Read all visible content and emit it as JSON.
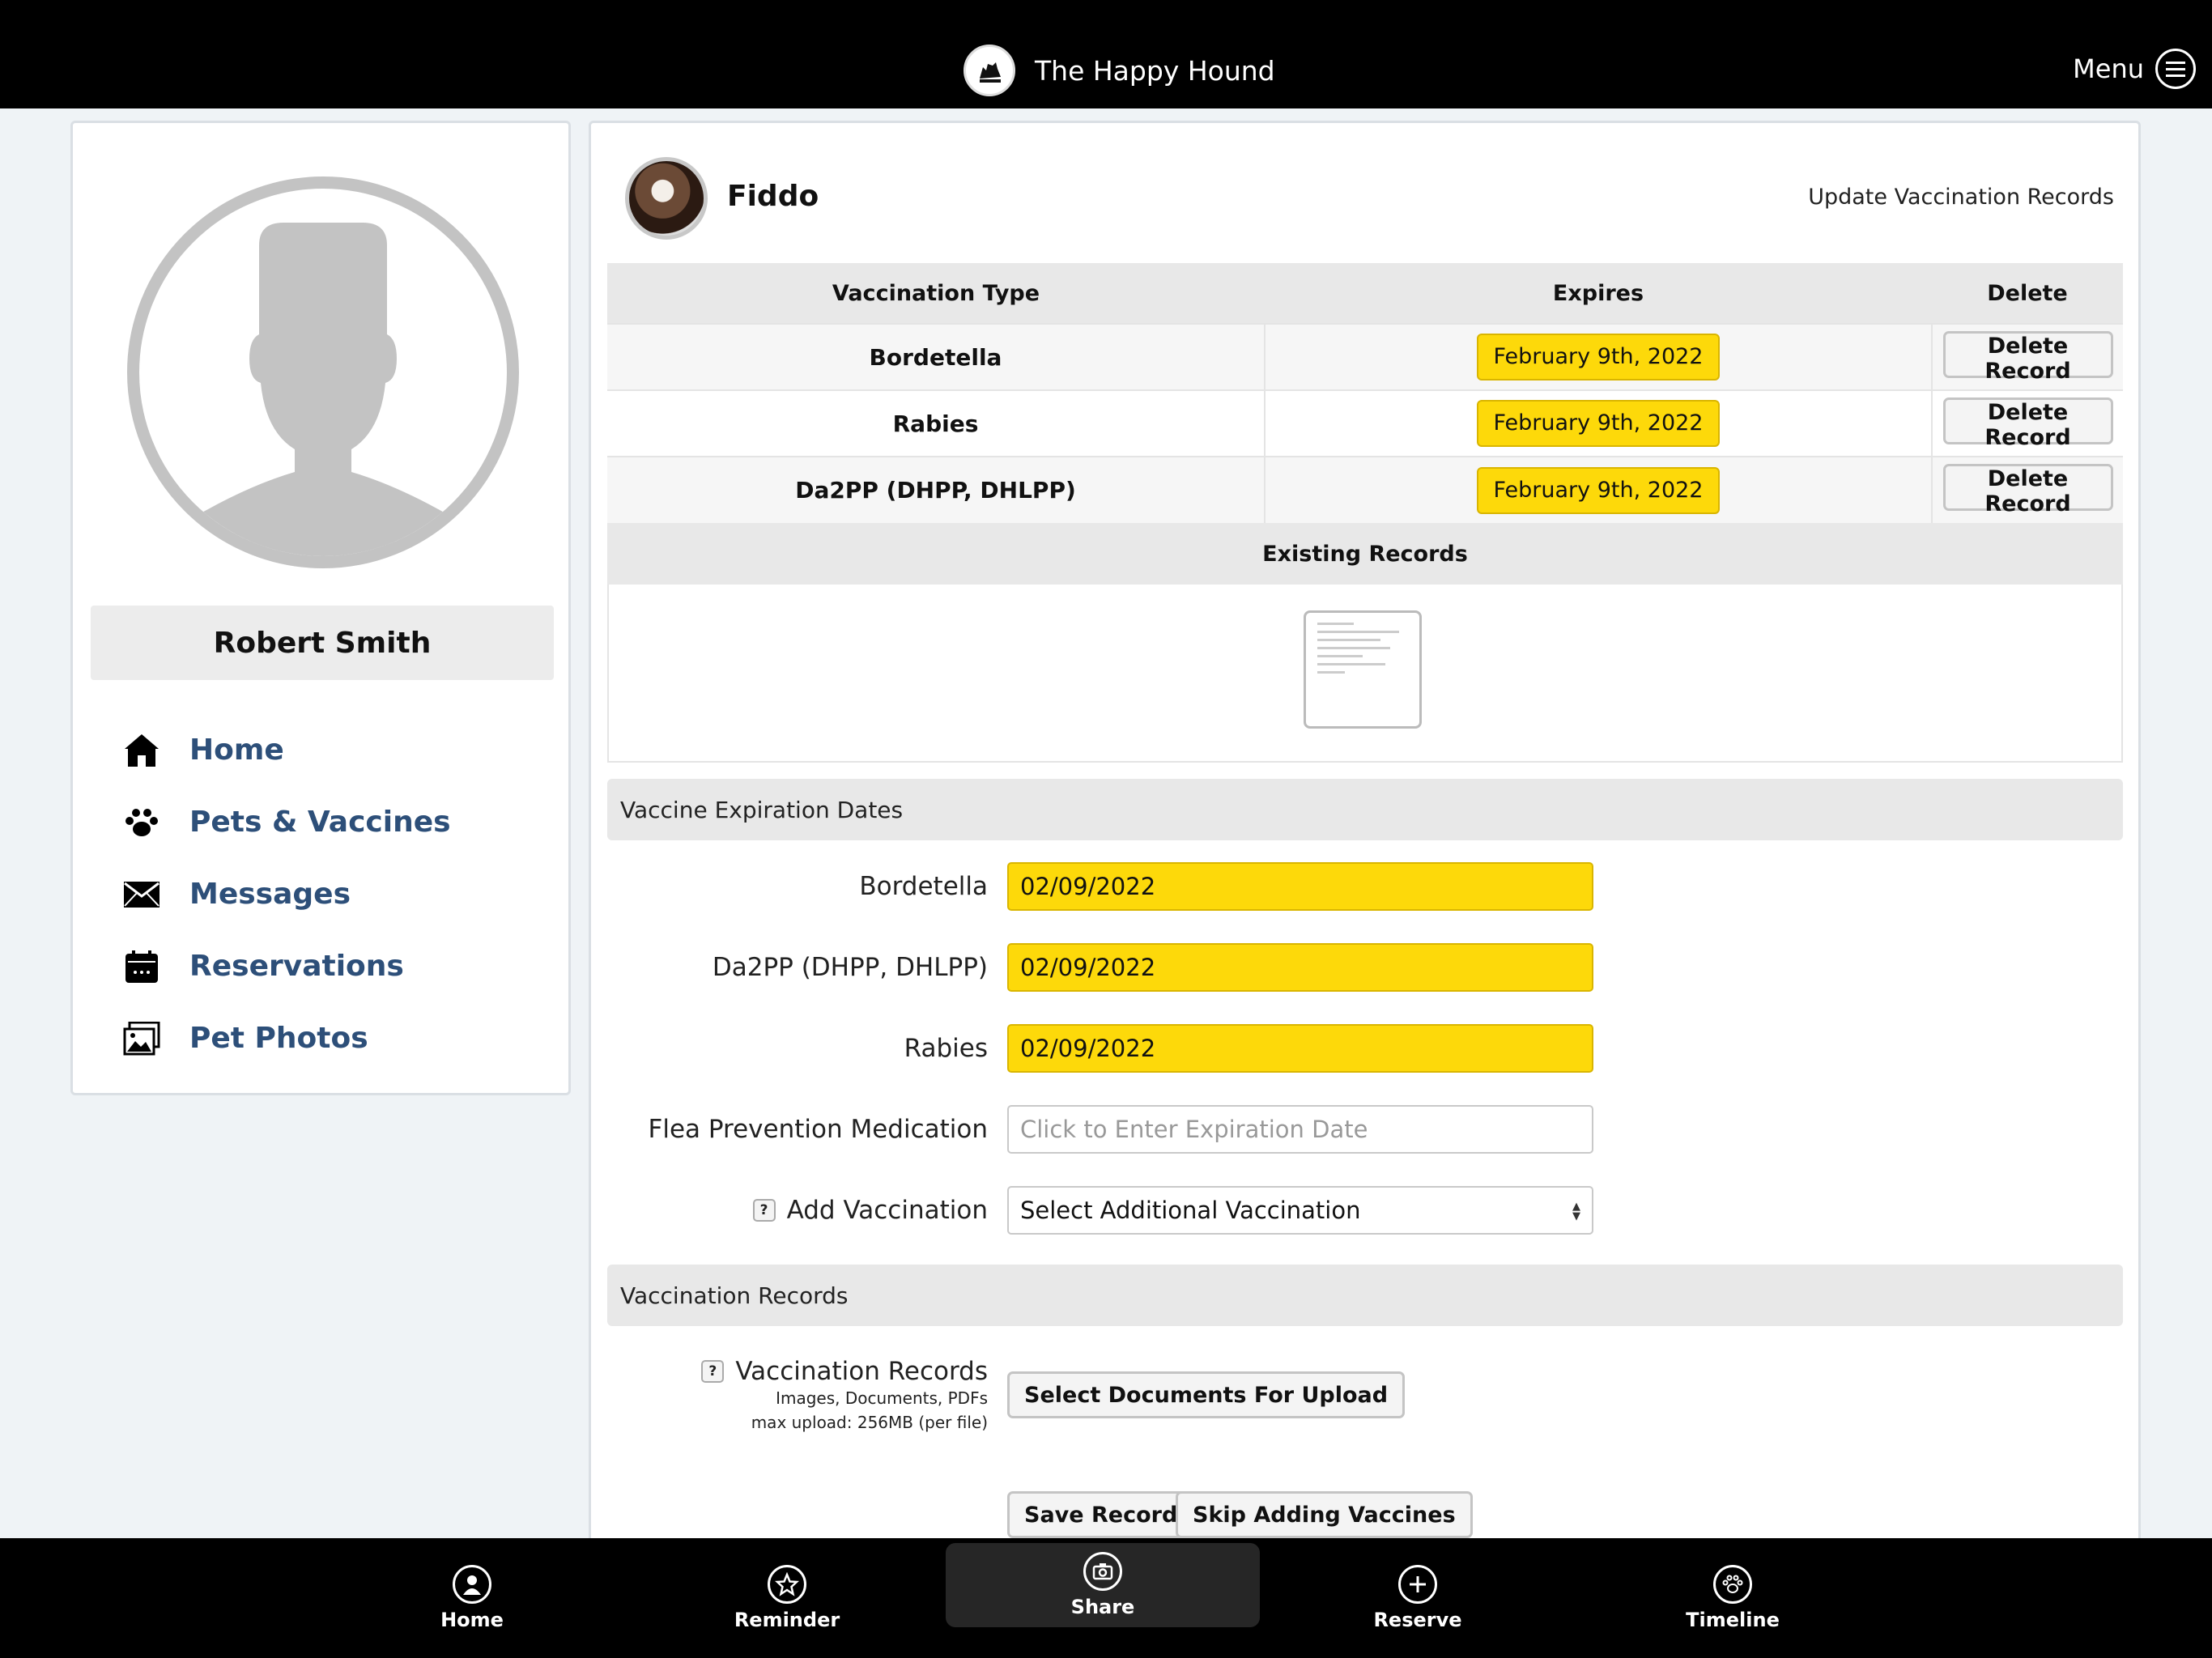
{
  "header": {
    "title": "The Happy Hound",
    "menu_label": "Menu"
  },
  "sidebar": {
    "user_name": "Robert Smith",
    "nav": [
      {
        "label": "Home",
        "icon": "home-icon"
      },
      {
        "label": "Pets & Vaccines",
        "icon": "paw-icon"
      },
      {
        "label": "Messages",
        "icon": "envelope-icon"
      },
      {
        "label": "Reservations",
        "icon": "calendar-icon"
      },
      {
        "label": "Pet Photos",
        "icon": "photos-icon"
      }
    ]
  },
  "main": {
    "pet_name": "Fiddo",
    "update_link": "Update Vaccination Records",
    "table": {
      "headers": [
        "Vaccination Type",
        "Expires",
        "Delete"
      ],
      "rows": [
        {
          "type": "Bordetella",
          "expires": "February 9th, 2022",
          "action": "Delete Record"
        },
        {
          "type": "Rabies",
          "expires": "February 9th, 2022",
          "action": "Delete Record"
        },
        {
          "type": "Da2PP (DHPP, DHLPP)",
          "expires": "February 9th, 2022",
          "action": "Delete Record"
        }
      ],
      "existing_records_label": "Existing Records"
    },
    "expiration_section": {
      "title": "Vaccine Expiration Dates",
      "fields": [
        {
          "label": "Bordetella",
          "value": "02/09/2022"
        },
        {
          "label": "Da2PP (DHPP, DHLPP)",
          "value": "02/09/2022"
        },
        {
          "label": "Rabies",
          "value": "02/09/2022"
        },
        {
          "label": "Flea Prevention Medication",
          "value": "",
          "placeholder": "Click to Enter Expiration Date"
        }
      ],
      "add_vaccination": {
        "label": "Add Vaccination",
        "help": "?",
        "selected": "Select Additional Vaccination"
      }
    },
    "records_section": {
      "title": "Vaccination Records",
      "label": "Vaccination Records",
      "help": "?",
      "sub1": "Images, Documents, PDFs",
      "sub2": "max upload: 256MB (per file)",
      "upload_button": "Select Documents For Upload",
      "save_button": "Save Record",
      "skip_button": "Skip Adding Vaccines"
    }
  },
  "bottom_nav": [
    {
      "label": "Home",
      "icon": "user-circle-icon",
      "active": false
    },
    {
      "label": "Reminder",
      "icon": "star-icon",
      "active": false
    },
    {
      "label": "Share",
      "icon": "camera-icon",
      "active": true
    },
    {
      "label": "Reserve",
      "icon": "plus-icon",
      "active": false
    },
    {
      "label": "Timeline",
      "icon": "paw-circle-icon",
      "active": false
    }
  ]
}
